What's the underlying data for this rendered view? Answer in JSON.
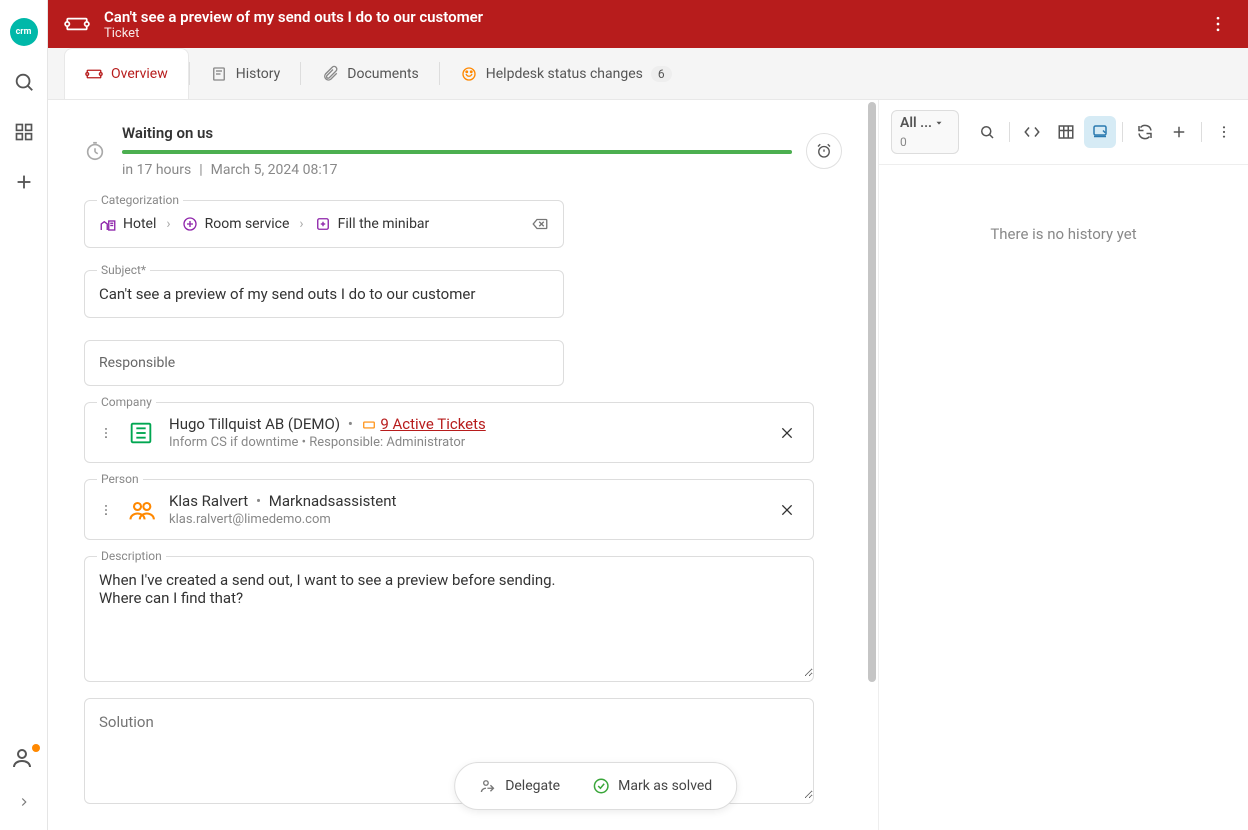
{
  "header": {
    "title": "Can't see a preview of my send outs I do to our customer",
    "subtitle": "Ticket"
  },
  "tabs": {
    "overview": "Overview",
    "history": "History",
    "documents": "Documents",
    "helpdesk": "Helpdesk status changes",
    "helpdesk_badge": "6"
  },
  "status": {
    "title": "Waiting on us",
    "relative": "in 17 hours",
    "timestamp": "March 5, 2024 08:17"
  },
  "categorization": {
    "label": "Categorization",
    "items": [
      "Hotel",
      "Room service",
      "Fill the minibar"
    ]
  },
  "subject": {
    "label": "Subject*",
    "value": "Can't see a preview of my send outs I do to our customer"
  },
  "responsible": {
    "placeholder": "Responsible"
  },
  "company": {
    "label": "Company",
    "name": "Hugo Tillquist AB (DEMO)",
    "tickets_label": "9 Active Tickets",
    "line2_a": "Inform CS if downtime",
    "line2_b": "Responsible: Administrator"
  },
  "person": {
    "label": "Person",
    "name": "Klas Ralvert",
    "role": "Marknadsassistent",
    "email": "klas.ralvert@limedemo.com"
  },
  "description": {
    "label": "Description",
    "value": "When I've created a send out, I want to see a preview before sending.\nWhere can I find that?"
  },
  "solution": {
    "label": "Solution"
  },
  "actions": {
    "delegate": "Delegate",
    "mark_solved": "Mark as solved"
  },
  "history_panel": {
    "filter_label": "All ...",
    "filter_count": "0",
    "empty": "There is no history yet"
  }
}
